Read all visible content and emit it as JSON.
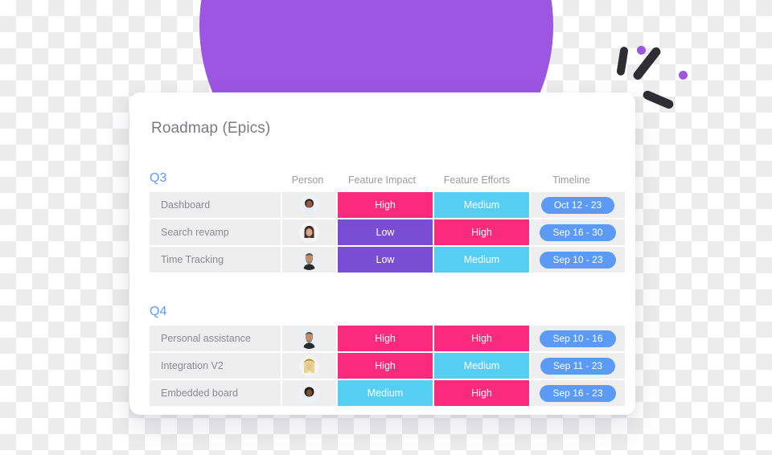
{
  "card": {
    "title": "Roadmap (Epics)"
  },
  "columns": {
    "person": "Person",
    "impact": "Feature Impact",
    "efforts": "Feature Efforts",
    "timeline": "Timeline"
  },
  "colors": {
    "accent_purple": "#9d56e2",
    "high_pink": "#fb2a7c",
    "medium_cyan": "#57cef4",
    "low_purple": "#7a4ed2",
    "timeline_blue": "#5b9bf6",
    "quarter_label": "#5b9bf6",
    "row_bg": "#eeeeee",
    "card_bg": "#ffffff"
  },
  "sections": [
    {
      "quarter": "Q3",
      "rows": [
        {
          "name": "Dashboard",
          "avatar": "avatar-woman-dark-hair",
          "impact": "High",
          "impact_level": "high",
          "efforts": "Medium",
          "efforts_level": "medium",
          "timeline": "Oct 12 - 23"
        },
        {
          "name": "Search revamp",
          "avatar": "avatar-woman-long-hair",
          "impact": "Low",
          "impact_level": "low",
          "efforts": "High",
          "efforts_level": "high",
          "timeline": "Sep 16 - 30"
        },
        {
          "name": "Time Tracking",
          "avatar": "avatar-man-beard",
          "impact": "Low",
          "impact_level": "low",
          "efforts": "Medium",
          "efforts_level": "medium",
          "timeline": "Sep 10 - 23"
        }
      ]
    },
    {
      "quarter": "Q4",
      "rows": [
        {
          "name": "Personal assistance",
          "avatar": "avatar-man-beard",
          "impact": "High",
          "impact_level": "high",
          "efforts": "High",
          "efforts_level": "high",
          "timeline": "Sep 10 - 16"
        },
        {
          "name": "Integration V2",
          "avatar": "avatar-blonde-hat",
          "impact": "High",
          "impact_level": "high",
          "efforts": "Medium",
          "efforts_level": "medium",
          "timeline": "Sep 11 - 23"
        },
        {
          "name": "Embedded board",
          "avatar": "avatar-woman-dark-hair",
          "impact": "Medium",
          "impact_level": "medium",
          "efforts": "High",
          "efforts_level": "high",
          "timeline": "Sep 16 - 23"
        }
      ]
    }
  ],
  "decoration": {
    "dome": "purple-dome-shape",
    "sparkle": "sparkle-confetti"
  }
}
